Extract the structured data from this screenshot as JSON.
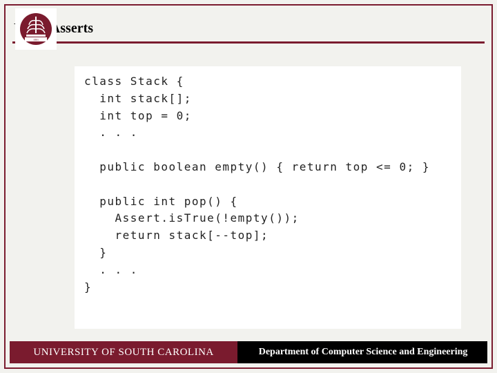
{
  "title": "Using Asserts",
  "code_lines": [
    "class Stack {",
    "  int stack[];",
    "  int top = 0;",
    "  . . .",
    "",
    "  public boolean empty() { return top <= 0; }",
    "",
    "  public int pop() {",
    "    Assert.isTrue(!empty());",
    "    return stack[--top];",
    "  }",
    "  . . .",
    "}"
  ],
  "footer": {
    "left": "UNIVERSITY OF SOUTH CAROLINA",
    "right": "Department of Computer Science and Engineering"
  },
  "logo": {
    "name": "usc-tree-logo",
    "color": "#7a1b2e"
  }
}
